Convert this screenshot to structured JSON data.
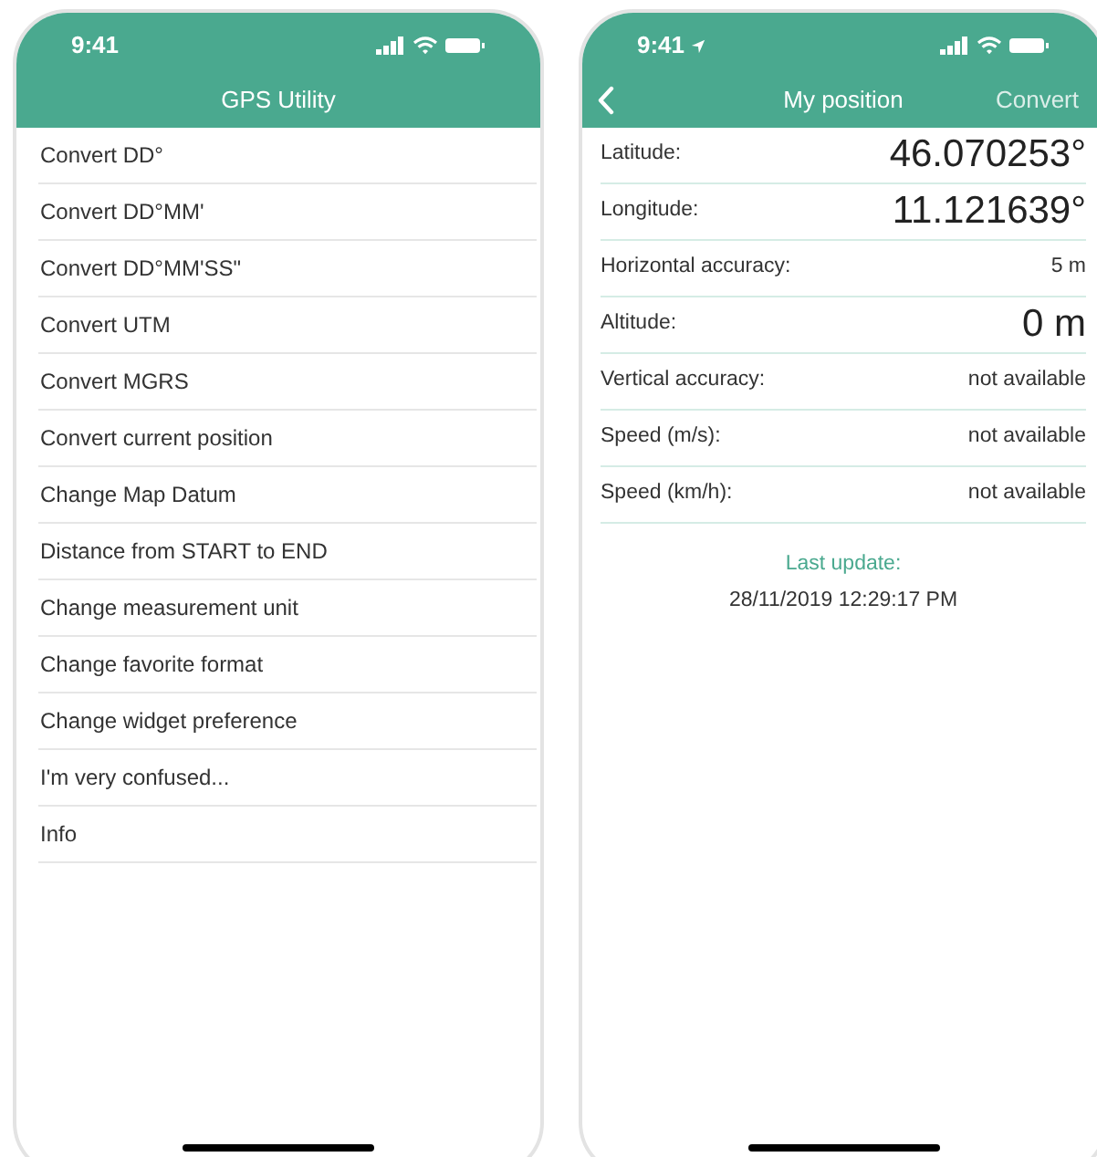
{
  "left_screen": {
    "status_bar": {
      "time": "9:41",
      "location_arrow": false
    },
    "nav": {
      "title": "GPS Utility"
    },
    "menu": [
      {
        "label": "Convert DD°"
      },
      {
        "label": "Convert DD°MM'"
      },
      {
        "label": "Convert DD°MM'SS\""
      },
      {
        "label": "Convert UTM"
      },
      {
        "label": "Convert MGRS"
      },
      {
        "label": "Convert current position"
      },
      {
        "label": "Change Map Datum"
      },
      {
        "label": "Distance from START to END"
      },
      {
        "label": "Change measurement unit"
      },
      {
        "label": "Change favorite format"
      },
      {
        "label": "Change widget preference"
      },
      {
        "label": "I'm very confused..."
      },
      {
        "label": "Info"
      }
    ]
  },
  "right_screen": {
    "status_bar": {
      "time": "9:41",
      "location_arrow": true
    },
    "nav": {
      "title": "My position",
      "action": "Convert"
    },
    "fields": [
      {
        "label": "Latitude:",
        "value": "46.070253°",
        "kind": "large"
      },
      {
        "label": "Longitude:",
        "value": "11.121639°",
        "kind": "large"
      },
      {
        "label": "Horizontal accuracy:",
        "value": "5 m",
        "kind": "small"
      },
      {
        "label": "Altitude:",
        "value": "0 m",
        "kind": "large"
      },
      {
        "label": "Vertical accuracy:",
        "value": "not available",
        "kind": "small"
      },
      {
        "label": "Speed (m/s):",
        "value": "not available",
        "kind": "small"
      },
      {
        "label": "Speed (km/h):",
        "value": "not available",
        "kind": "small"
      }
    ],
    "last_update": {
      "label": "Last update:",
      "value": "28/11/2019 12:29:17 PM"
    }
  }
}
